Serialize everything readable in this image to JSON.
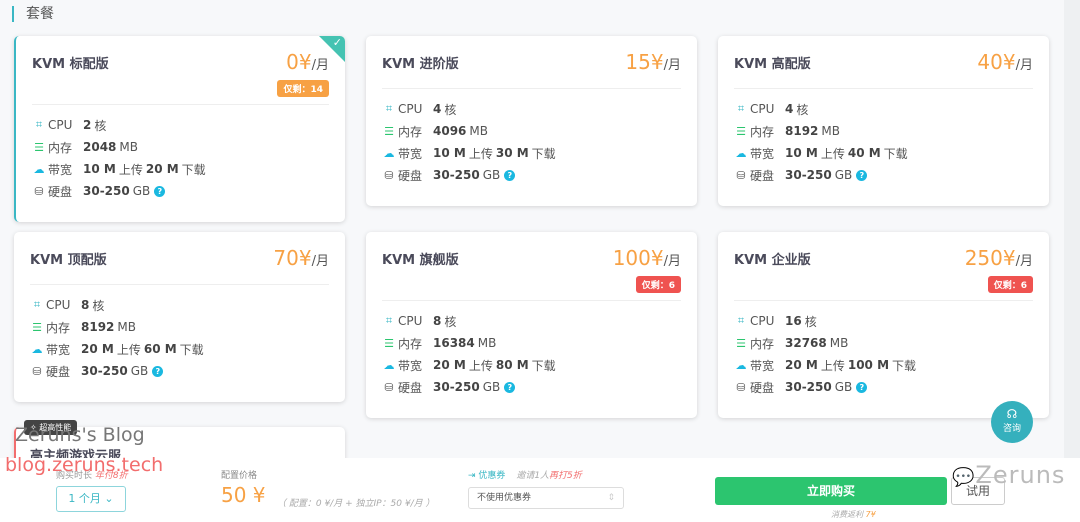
{
  "section_title": "套餐",
  "cards": [
    {
      "title": "KVM 标配版",
      "price": "0¥",
      "unit": "/月",
      "badge": "仅剩：14",
      "badge_color": "#f7a144",
      "selected": true,
      "cpu": "2",
      "mem": "2048",
      "up": "10 M",
      "down": "20 M",
      "disk": "30-250"
    },
    {
      "title": "KVM 进阶版",
      "price": "15¥",
      "unit": "/月",
      "badge": "",
      "cpu": "4",
      "mem": "4096",
      "up": "10 M",
      "down": "30 M",
      "disk": "30-250"
    },
    {
      "title": "KVM 高配版",
      "price": "40¥",
      "unit": "/月",
      "badge": "",
      "cpu": "4",
      "mem": "8192",
      "up": "10 M",
      "down": "40 M",
      "disk": "30-250"
    },
    {
      "title": "KVM 顶配版",
      "price": "70¥",
      "unit": "/月",
      "badge": "",
      "cpu": "8",
      "mem": "8192",
      "up": "20 M",
      "down": "60 M",
      "disk": "30-250"
    },
    {
      "title": "KVM 旗舰版",
      "price": "100¥",
      "unit": "/月",
      "badge": "仅剩：6",
      "badge_color": "#ef5350",
      "cpu": "8",
      "mem": "16384",
      "up": "20 M",
      "down": "80 M",
      "disk": "30-250"
    },
    {
      "title": "KVM 企业版",
      "price": "250¥",
      "unit": "/月",
      "badge": "仅剩：6",
      "badge_color": "#ef5350",
      "cpu": "16",
      "mem": "32768",
      "up": "20 M",
      "down": "100 M",
      "disk": "30-250"
    }
  ],
  "spec_labels": {
    "cpu": "CPU",
    "mem": "内存",
    "bw": "带宽",
    "disk": "硬盘",
    "core": "核",
    "mb": "MB",
    "up": "上传",
    "down": "下载",
    "gb": "GB",
    "help": "?"
  },
  "card7": {
    "tag": "超高性能",
    "title": "高主频游戏云服"
  },
  "footer": {
    "duration_label": "购买时长",
    "duration_promo": "年付8折",
    "duration_value": "1 个月",
    "price_label": "配置价格",
    "price": "50 ¥",
    "price_detail": "（ 配置：0 ¥/月 + 独立IP：50 ¥/月 ）",
    "coupon_label": "优惠券",
    "coupon_invite": "邀请1人",
    "coupon_invite_promo": "再打5折",
    "coupon_value": "不使用优惠券",
    "buy_label": "立即购买",
    "trial_label": "试用",
    "rebate_label": "消费返利",
    "rebate_value": "7¥"
  },
  "consult_label": "咨询",
  "watermarks": {
    "blog": "Zeruns's Blog",
    "url": "blog.zeruns.tech",
    "wechat": "Zeruns"
  },
  "colors": {
    "accent": "#3ab7c4",
    "price": "#f7a144",
    "buy": "#2cc56f"
  }
}
